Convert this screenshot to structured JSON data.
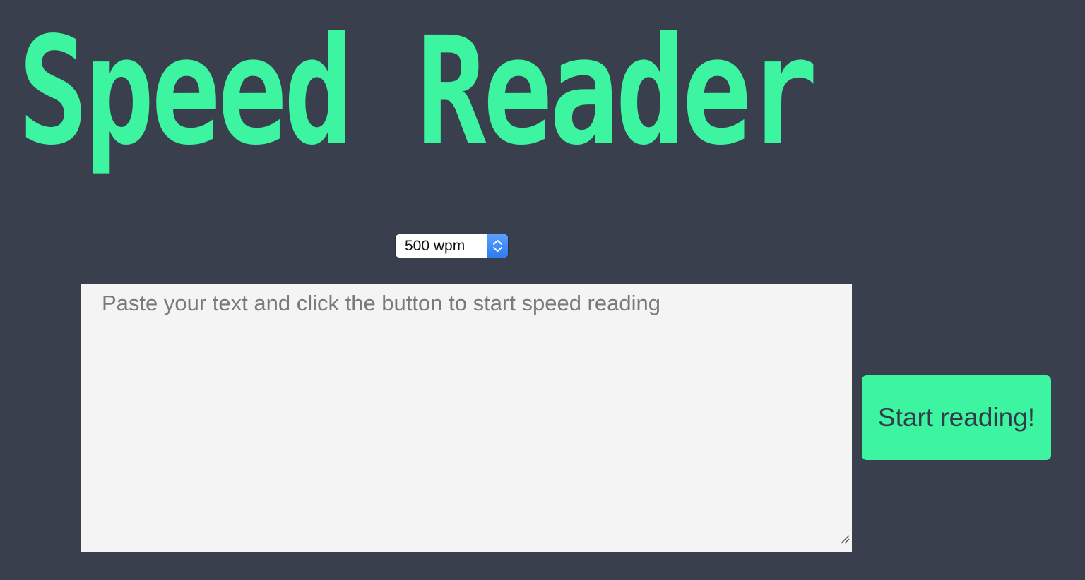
{
  "header": {
    "title": "Speed Reader"
  },
  "speed_select": {
    "selected": "500 wpm"
  },
  "text_input": {
    "value": "",
    "placeholder": "Paste your text and click the button to start speed reading"
  },
  "start_button": {
    "label": "Start reading!"
  },
  "colors": {
    "background": "#3a3f4e",
    "accent": "#3df5a0",
    "textarea_bg": "#f4f4f4",
    "button_text": "#333a48"
  }
}
